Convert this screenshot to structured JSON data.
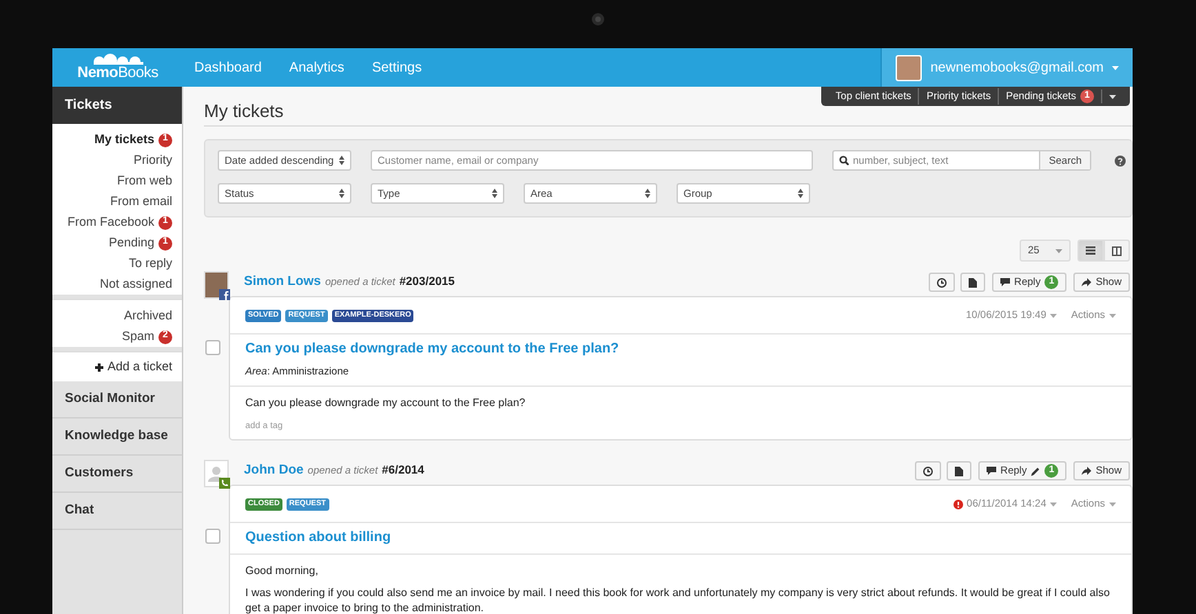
{
  "logo": "**Nemo**Books",
  "nav": [
    {
      "label": "Dashboard"
    },
    {
      "label": "Analytics"
    },
    {
      "label": "Settings"
    }
  ],
  "user": {
    "email": "newnemobooks@gmail.com"
  },
  "quick_tabs": [
    {
      "label": "Top client tickets"
    },
    {
      "label": "Priority tickets"
    },
    {
      "label": "Pending tickets",
      "badge": "1"
    }
  ],
  "sidebar": {
    "title": "Tickets",
    "items": [
      {
        "label": "My tickets",
        "selected": true,
        "badge": "1"
      },
      {
        "label": "Priority",
        "selected": false
      },
      {
        "label": "From web",
        "selected": false
      },
      {
        "label": "From email",
        "selected": false
      },
      {
        "label": "From Facebook",
        "selected": false,
        "badge": "1"
      },
      {
        "label": "Pending",
        "selected": false,
        "badge": "1"
      },
      {
        "label": "To reply",
        "selected": false
      },
      {
        "label": "Not assigned",
        "selected": false
      }
    ],
    "lower_items": [
      {
        "label": "Archived",
        "selected": false
      },
      {
        "label": "Spam",
        "selected": false,
        "badge": "2"
      }
    ],
    "add_label": "Add a ticket",
    "sections": [
      "Social Monitor",
      "Knowledge base",
      "Customers",
      "Chat"
    ]
  },
  "page_title": "My tickets",
  "filters": {
    "sort": "Date added descending",
    "customer_placeholder": "Customer name, email or company",
    "search_placeholder": "number, subject, text",
    "search_button": "Search",
    "selects": [
      "Status",
      "Type",
      "Area",
      "Group"
    ]
  },
  "per_page": "25",
  "views": [
    {
      "kind": "list",
      "selected": true
    },
    {
      "kind": "columns",
      "selected": false
    }
  ],
  "tickets": [
    {
      "author": "Simon Lows",
      "action": "opened a ticket",
      "number": "#203/2015",
      "source": {
        "kind": "facebook"
      },
      "avatar": {
        "kind": "photo"
      },
      "reply": "Reply",
      "reply_count": "1",
      "reply_edit": false,
      "show": "Show",
      "tags": [
        {
          "label": "SOLVED",
          "color": "#2f7fc1"
        },
        {
          "label": "REQUEST",
          "color": "#3b8fc9"
        },
        {
          "label": "EXAMPLE-DESKERO",
          "color": "#2b4a94"
        }
      ],
      "date": "10/06/2015 19:49",
      "overdue": false,
      "actions": "Actions",
      "subject": "Can you please downgrade my account to the Free plan?",
      "area": "*Area*: Amministrazione",
      "body": [
        "Can you please downgrade my account to the Free plan?"
      ],
      "add_tag": "add a tag",
      "checked": false
    },
    {
      "author": "John Doe",
      "action": "opened a ticket",
      "number": "#6/2014",
      "source": {
        "kind": "phone"
      },
      "avatar": {
        "kind": "generic"
      },
      "reply": "Reply",
      "reply_count": "1",
      "reply_edit": true,
      "show": "Show",
      "tags": [
        {
          "label": "CLOSED",
          "color": "#3d8b3d"
        },
        {
          "label": "REQUEST",
          "color": "#3b8fc9"
        }
      ],
      "date": "06/11/2014 14:24",
      "overdue": true,
      "actions": "Actions",
      "subject": "Question about billing",
      "body": [
        "Good morning,",
        "I was wondering if you could also send me an invoice by mail. I need this book for work and unfortunately my company is very strict about refunds. It would be great if I could also get a paper invoice to bring to the administration."
      ],
      "checked": false
    }
  ]
}
